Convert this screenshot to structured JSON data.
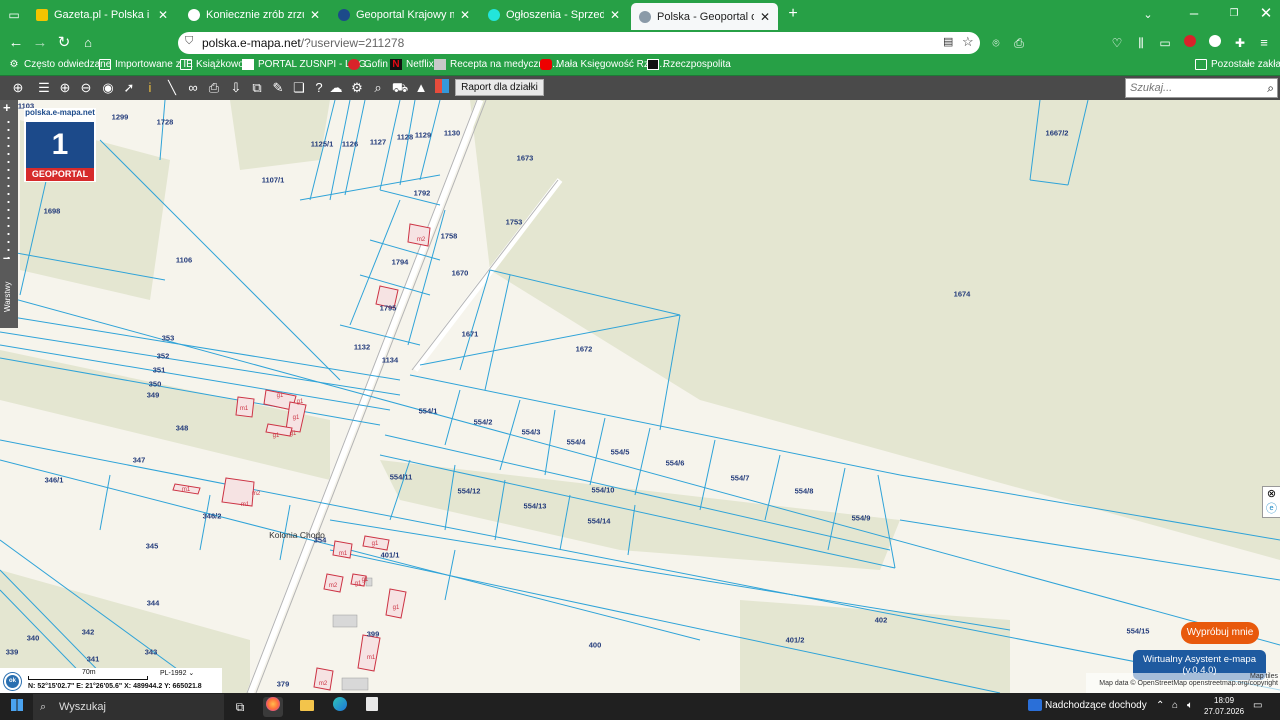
{
  "browser": {
    "tabs": [
      {
        "title": "Gazeta.pl - Polska i świat - wiado",
        "active": false
      },
      {
        "title": "Koniecznie zrób zrzut ekranu z g",
        "active": false
      },
      {
        "title": "Geoportal Krajowy mapy i inforr",
        "active": false
      },
      {
        "title": "Ogłoszenia - Sprzedam, kupię n",
        "active": false
      },
      {
        "title": "Polska - Geoportal otwartych da",
        "active": true
      }
    ],
    "new_tab": "+",
    "url_host": "polska.e-mapa.net",
    "url_rest": "/?userview=211278"
  },
  "bookmarks": {
    "items": [
      "Często odwiedzane",
      "Importowane z IE",
      "Książkowość",
      "PORTAL ZUSNPI - LOG...",
      "Gofin",
      "Netflix",
      "Recepta na medyczną ...",
      "Mała Księgowość Rzec...",
      "Rzeczpospolita"
    ],
    "other": "Pozostałe zakładki"
  },
  "toolbar": {
    "raport_label": "Raport dla działki",
    "search_placeholder": "Szukaj..."
  },
  "logo": {
    "site": "polska.e-mapa.net",
    "number": "1",
    "name": "GEOPORTAL"
  },
  "left_panel": {
    "layers_label": "Warstwy"
  },
  "parcels": [
    "1299",
    "1728",
    "1103",
    "1125/1",
    "1126",
    "1127",
    "1128",
    "1129",
    "1130",
    "1673",
    "1667/2",
    "1107/1",
    "1792",
    "1698",
    "1753",
    "1758",
    "1794",
    "1670",
    "1106",
    "1674",
    "1795",
    "1671",
    "353",
    "1132",
    "1672",
    "352",
    "1134",
    "351",
    "350",
    "349",
    "554/1",
    "554/2",
    "554/3",
    "554/4",
    "348",
    "554/5",
    "554/6",
    "554/7",
    "554/8",
    "347",
    "554/11",
    "554/10",
    "346/1",
    "554/12",
    "554/13",
    "554/14",
    "554/9",
    "346/2",
    "345",
    "354",
    "401/1",
    "344",
    "399",
    "402",
    "401/2",
    "340",
    "342",
    "400",
    "554/15",
    "339",
    "341",
    "343",
    "379"
  ],
  "building_labels": [
    "m2",
    "m1",
    "g1",
    "m1",
    "m2",
    "g1",
    "g1",
    "m1",
    "m2",
    "g1",
    "g1",
    "m1",
    "g1",
    "m1",
    "g1",
    "g1",
    "g1",
    "m2"
  ],
  "place_label": "Kolonia Chodo",
  "scale": {
    "length": "70m",
    "crs": "PL-1992",
    "ok": "ok",
    "coords": "N: 52°15'02.7\"  E: 21°26'05.6\"   X: 489944.2   Y: 665021.8"
  },
  "assistant": {
    "try_label": "Wypróbuj mnie",
    "name": "Wirtualny Asystent e-mapa",
    "version": "(v.0.4.0)"
  },
  "attribution": {
    "tiles": "Map tiles",
    "data": "Map data © OpenStreetMap",
    "copyright": "openstreetmap.org/copyright"
  },
  "taskbar": {
    "search": "Wyszukaj",
    "weather": "Nadchodzące dochody",
    "time": "18:09",
    "date": "27.07.2026"
  },
  "colors": {
    "browser_green": "#27a046",
    "parcel_line": "#2fa3d8",
    "label_blue": "#223a7a",
    "building_red": "#cc3344",
    "vegetation": "#e5e7d3"
  }
}
